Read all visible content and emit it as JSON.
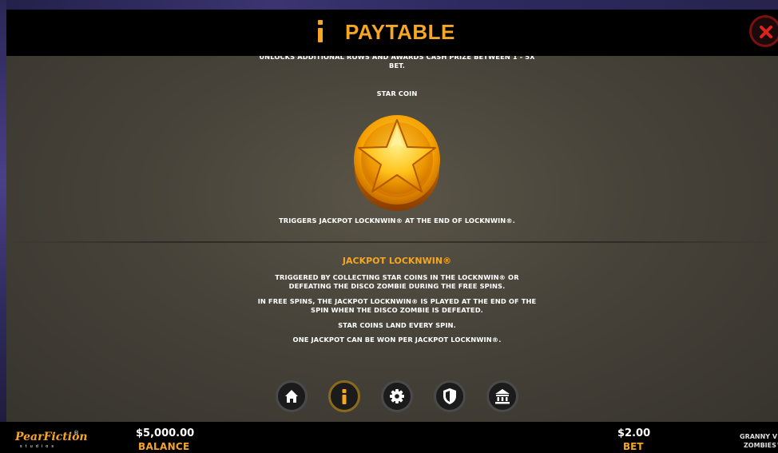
{
  "header": {
    "title": "PAYTABLE",
    "info_icon": "info-icon",
    "close_icon": "close-icon",
    "accent_color": "#f5a623"
  },
  "content": {
    "clipped_text": "UNLOCKS ADDITIONAL ROWS AND AWARDS CASH PRIZE BETWEEN 1 - 5X BET.",
    "star_coin_title": "STAR COIN",
    "star_coin_desc": "TRIGGERS JACKPOT LOCKNWIN® AT THE END OF LOCKNWIN®.",
    "jackpot_title": "JACKPOT LOCKNWIN®",
    "jackpot_lines": [
      "TRIGGERED BY COLLECTING STAR COINS IN THE LOCKNWIN® OR DEFEATING THE DISCO ZOMBIE DURING THE FREE SPINS.",
      "IN FREE SPINS, THE JACKPOT LOCKNWIN® IS PLAYED AT THE END OF THE SPIN WHEN THE DISCO ZOMBIE IS DEFEATED.",
      "STAR COINS LAND EVERY SPIN.",
      "ONE JACKPOT CAN BE WON PER JACKPOT LOCKNWIN®."
    ]
  },
  "nav": {
    "buttons": [
      {
        "icon": "home-icon",
        "active": false
      },
      {
        "icon": "info-icon",
        "active": true
      },
      {
        "icon": "settings-gear-icon",
        "active": false
      },
      {
        "icon": "shield-icon",
        "active": false
      },
      {
        "icon": "bank-icon",
        "active": false
      }
    ]
  },
  "footer": {
    "logo_text": "PearFiction",
    "logo_sub": "studios",
    "balance_value": "$5,000.00",
    "balance_label": "BALANCE",
    "bet_value": "$2.00",
    "bet_label": "BET",
    "game_title_line1": "GRANNY V",
    "game_title_line2": "ZOMBIES™"
  }
}
